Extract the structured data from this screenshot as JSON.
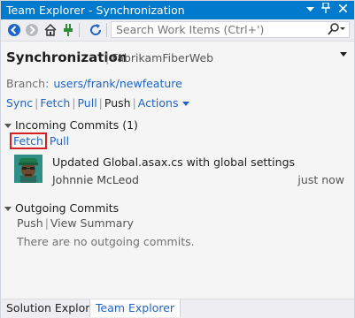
{
  "window": {
    "title": "Team Explorer - Synchronization",
    "buttons": [
      "dropdown-icon",
      "pin-icon",
      "close-icon"
    ]
  },
  "toolbar": {
    "icons": [
      "back-icon",
      "forward-icon",
      "home-icon",
      "connect-icon",
      "refresh-icon"
    ],
    "search_placeholder": "Search Work Items (Ctrl+')"
  },
  "page": {
    "title": "Synchronization",
    "subtitle": "FabrikamFiberWeb"
  },
  "branch": {
    "label": "Branch:",
    "name": "users/frank/newfeature"
  },
  "actions": {
    "sync": "Sync",
    "fetch": "Fetch",
    "pull": "Pull",
    "push": "Push",
    "actions": "Actions"
  },
  "incoming": {
    "header": "Incoming Commits (1)",
    "fetch": "Fetch",
    "pull": "Pull",
    "commits": [
      {
        "message": "Updated Global.asax.cs with global settings",
        "author": "Johnnie McLeod",
        "time": "just now"
      }
    ]
  },
  "outgoing": {
    "header": "Outgoing Commits",
    "push": "Push",
    "view_summary": "View Summary",
    "empty": "There are no outgoing commits."
  },
  "tabs": [
    {
      "label": "Solution Explorer",
      "active": false
    },
    {
      "label": "Team Explorer",
      "active": true
    }
  ],
  "colors": {
    "accent": "#007acc",
    "link": "#1e64c8",
    "highlight": "#d32020"
  }
}
